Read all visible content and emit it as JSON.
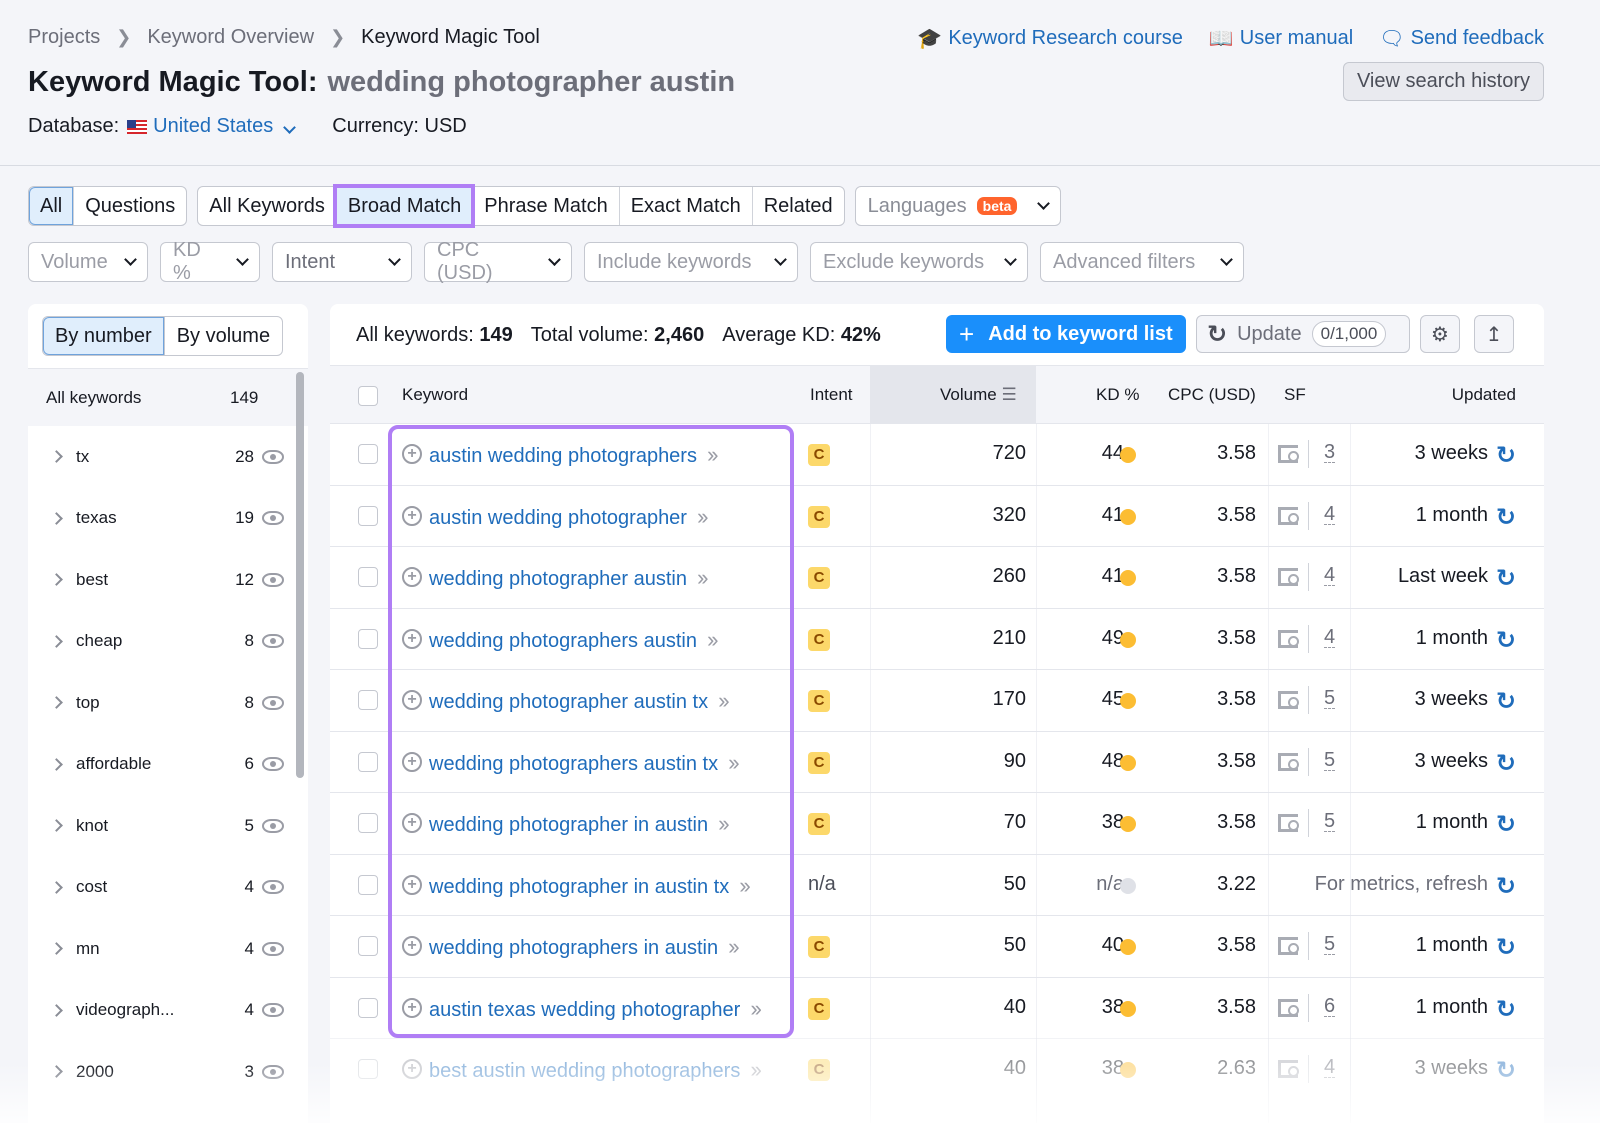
{
  "breadcrumb": [
    "Projects",
    "Keyword Overview",
    "Keyword Magic Tool"
  ],
  "header": {
    "title": "Keyword Magic Tool:",
    "query": "wedding photographer austin",
    "database_label": "Database:",
    "database_value": "United States",
    "currency": "Currency: USD",
    "links": [
      {
        "icon": "graduation-cap-icon",
        "label": "Keyword Research course"
      },
      {
        "icon": "book-icon",
        "label": "User manual"
      },
      {
        "icon": "chat-bubble-icon",
        "label": "Send feedback"
      }
    ],
    "history_button": "View search history"
  },
  "tabs": {
    "type": [
      "All",
      "Questions"
    ],
    "match": [
      "All Keywords",
      "Broad Match",
      "Phrase Match",
      "Exact Match",
      "Related"
    ],
    "active_type": "All",
    "active_match": "Broad Match",
    "languages": "Languages",
    "beta": "beta"
  },
  "filters": [
    "Volume",
    "KD %",
    "Intent",
    "CPC (USD)",
    "Include keywords",
    "Exclude keywords",
    "Advanced filters"
  ],
  "sidebar": {
    "toggle": [
      "By number",
      "By volume"
    ],
    "all_label": "All keywords",
    "all_count": "149",
    "groups": [
      {
        "name": "tx",
        "count": "28"
      },
      {
        "name": "texas",
        "count": "19"
      },
      {
        "name": "best",
        "count": "12"
      },
      {
        "name": "cheap",
        "count": "8"
      },
      {
        "name": "top",
        "count": "8"
      },
      {
        "name": "affordable",
        "count": "6"
      },
      {
        "name": "knot",
        "count": "5"
      },
      {
        "name": "cost",
        "count": "4"
      },
      {
        "name": "mn",
        "count": "4"
      },
      {
        "name": "videograph...",
        "count": "4"
      },
      {
        "name": "2000",
        "count": "3"
      }
    ]
  },
  "summary": {
    "all_label": "All keywords:",
    "all_value": "149",
    "vol_label": "Total volume:",
    "vol_value": "2,460",
    "kd_label": "Average KD:",
    "kd_value": "42%"
  },
  "toolbar": {
    "add": "Add to keyword list",
    "update": "Update",
    "quota": "0/1,000"
  },
  "columns": [
    "Keyword",
    "Intent",
    "Volume",
    "KD %",
    "CPC (USD)",
    "SF",
    "Updated"
  ],
  "rows": [
    {
      "keyword": "austin wedding photographers",
      "intent": "C",
      "volume": "720",
      "kd": "44",
      "cpc": "3.58",
      "sf": "3",
      "updated": "3 weeks"
    },
    {
      "keyword": "austin wedding photographer",
      "intent": "C",
      "volume": "320",
      "kd": "41",
      "cpc": "3.58",
      "sf": "4",
      "updated": "1 month"
    },
    {
      "keyword": "wedding photographer austin",
      "intent": "C",
      "volume": "260",
      "kd": "41",
      "cpc": "3.58",
      "sf": "4",
      "updated": "Last week"
    },
    {
      "keyword": "wedding photographers austin",
      "intent": "C",
      "volume": "210",
      "kd": "49",
      "cpc": "3.58",
      "sf": "4",
      "updated": "1 month"
    },
    {
      "keyword": "wedding photographer austin tx",
      "intent": "C",
      "volume": "170",
      "kd": "45",
      "cpc": "3.58",
      "sf": "5",
      "updated": "3 weeks"
    },
    {
      "keyword": "wedding photographers austin tx",
      "intent": "C",
      "volume": "90",
      "kd": "48",
      "cpc": "3.58",
      "sf": "5",
      "updated": "3 weeks"
    },
    {
      "keyword": "wedding photographer in austin",
      "intent": "C",
      "volume": "70",
      "kd": "38",
      "cpc": "3.58",
      "sf": "5",
      "updated": "1 month"
    },
    {
      "keyword": "wedding photographer in austin tx",
      "intent": "n/a",
      "volume": "50",
      "kd": "n/a",
      "cpc": "3.22",
      "sf": "",
      "updated": "For metrics, refresh"
    },
    {
      "keyword": "wedding photographers in austin",
      "intent": "C",
      "volume": "50",
      "kd": "40",
      "cpc": "3.58",
      "sf": "5",
      "updated": "1 month"
    },
    {
      "keyword": "austin texas wedding photographer",
      "intent": "C",
      "volume": "40",
      "kd": "38",
      "cpc": "3.58",
      "sf": "6",
      "updated": "1 month"
    },
    {
      "keyword": "best austin wedding photographers",
      "intent": "C",
      "volume": "40",
      "kd": "38",
      "cpc": "2.63",
      "sf": "4",
      "updated": "3 weeks"
    }
  ],
  "colors": {
    "accent": "#1a8ffb",
    "link": "#1f6cbb",
    "highlight": "#b07ef5",
    "kd_medium": "#fcbd33",
    "beta": "#ff642d"
  }
}
